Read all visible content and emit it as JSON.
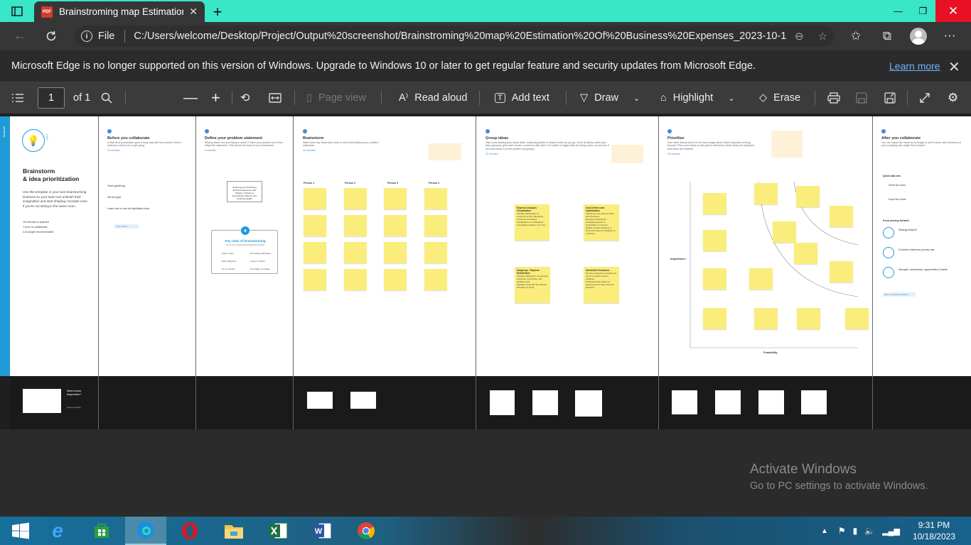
{
  "browser": {
    "tab_title": "Brainstroming map Estimation Of Business Expenses_2023-10-13_07",
    "file_label": "File",
    "url": "C:/Users/welcome/Desktop/Project/Output%20screenshot/Brainstroming%20map%20Estimation%20Of%20Business%20Expenses_2023-10-13_07...",
    "pdf_badge": "PDF"
  },
  "infobar": {
    "message": "Microsoft Edge is no longer supported on this version of Windows. Upgrade to Windows 10 or later to get regular feature and security updates from Microsoft Edge.",
    "learn_more": "Learn more"
  },
  "pdf_toolbar": {
    "page_number": "1",
    "page_total": "of 1",
    "page_view": "Page view",
    "read_aloud": "Read aloud",
    "add_text": "Add text",
    "draw": "Draw",
    "highlight": "Highlight",
    "erase": "Erase"
  },
  "document": {
    "template_tag": "Template",
    "intro_title_line1": "Brainstorm",
    "intro_title_line2": "& idea prioritization",
    "intro_desc": "Use this template in your own brainstorming sessions so your team can unleash their imagination and start shaping concepts even if you're not sitting in the same room.",
    "intro_bullets": [
      "10 minutes to prepare",
      "1 hour to collaborate",
      "2-8 people recommended"
    ],
    "sections": [
      {
        "title": "Before you collaborate",
        "desc": "A little bit of preparation goes a long way with this session. Here's what you need to do to get going.",
        "time": "10 minutes"
      },
      {
        "title": "Define your problem statement",
        "desc": "What problem are you trying to solve? Frame your problem as a How Might We statement. This will be the focus of your brainstorm.",
        "time": "5 minutes"
      },
      {
        "title": "Brainstorm",
        "desc": "Write down any ideas that come to mind that address your problem statement.",
        "time": "10 minutes"
      },
      {
        "title": "Group ideas",
        "desc": "Take turns sharing your ideas while clustering similar or related notes as you go. Once all sticky notes have been grouped, give each cluster a sentence-like label. If a cluster is bigger than six sticky notes, try and see if you and break it up into smaller sub-groups.",
        "time": "20 minutes"
      },
      {
        "title": "Prioritize",
        "desc": "Your team should all be on the same page about what's important moving forward. Place your ideas on this grid to determine which ideas are important and which are feasible.",
        "time": "20 minutes"
      },
      {
        "title": "After you collaborate",
        "desc": "You can export the mural as an image or pdf to share with members of your company who might find it helpful."
      }
    ],
    "before_steps": [
      "Team gathering",
      "Set the goal",
      "Learn how to use the facilitation tools"
    ],
    "open_article": "Open article",
    "problem_card": "Analyzing and Optimizing Business Expenses with Tableau: A Study on Expenditure Patterns and Financial Health",
    "key_rules_title": "Key rules of brainstorming",
    "key_rules_sub": "To run an smooth and productive session",
    "key_rules": [
      "Stay in topic.",
      "Encourage wild ideas.",
      "Defer judgment.",
      "Listen to others.",
      "Go for volume.",
      "If possible, be visual."
    ],
    "persons": [
      "Person 1",
      "Person 2",
      "Person 3",
      "Person 4"
    ],
    "group_labels": [
      {
        "title": "Expense Analysis Visualization",
        "items": [
          "Visualize distribution of expenses across categories.",
          "Create trend analysis visualizations to understand expenditure patterns over time."
        ]
      },
      {
        "title": "Cost Drivers and Optimization",
        "items": [
          "Identify key cost drivers within each business.",
          "Develop a dashboard showcasing areas of optimization or concern.",
          "Enable scenario analysis to show the impact of variables on expenses."
        ]
      },
      {
        "title": "Subgroup - Expense Distribution",
        "items": [
          "Visualize distribution of operating expenses, overheads, and variable costs.",
          "Highlight areas with the highest allocation of funds."
        ]
      },
      {
        "title": "Interactive Scenarios",
        "items": [
          "Develop interactive scenarios for users to explore various variables.",
          "Understand the impact on expenses and make informed decisions."
        ]
      }
    ],
    "axis_importance": "Importance",
    "axis_feasibility": "Feasibility",
    "after_items": [
      "Quick add-ons",
      "Share the mural",
      "Export the mural",
      "Keep moving forward",
      "Strategy blueprint",
      "Customer experience journey map",
      "Strengths, weaknesses, opportunities & threats"
    ],
    "share_feedback": "Share template feedback",
    "need_inspiration": "Need some inspiration?",
    "open_example": "Open example"
  },
  "watermark": {
    "title": "Activate Windows",
    "subtitle": "Go to PC settings to activate Windows."
  },
  "taskbar": {
    "time": "9:31 PM",
    "date": "10/18/2023"
  }
}
